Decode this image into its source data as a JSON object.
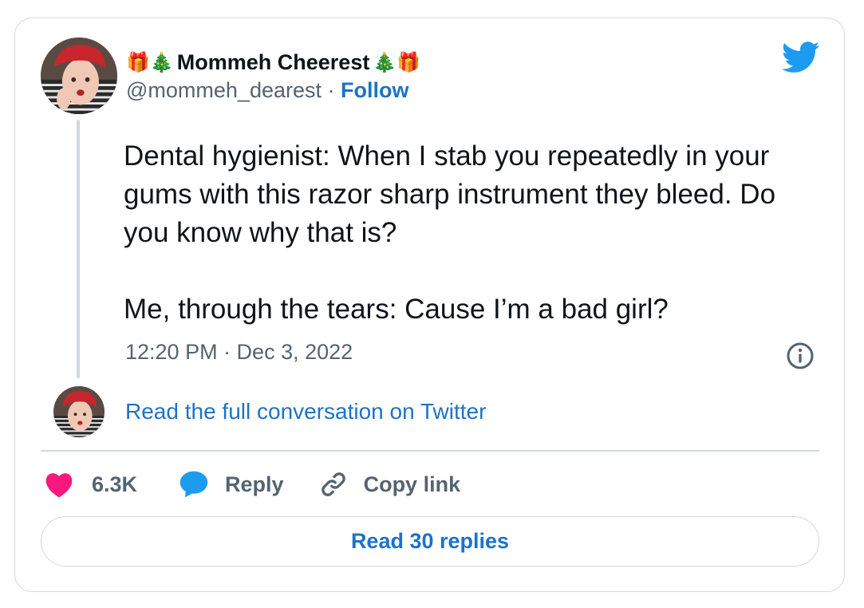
{
  "author": {
    "display_name": "Mommeh Cheerest",
    "name_emoji_left": "🎁🎄",
    "name_emoji_right": "🎄🎁",
    "handle": "@mommeh_dearest",
    "separator": "·",
    "follow_label": "Follow"
  },
  "tweet": {
    "text": "Dental hygienist: When I stab you repeatedly in your gums with this razor sharp instrument they bleed. Do you know why that is?\n\nMe, through the tears: Cause I’m a bad girl?",
    "timestamp": "12:20 PM · Dec 3, 2022"
  },
  "read_full_conversation_label": "Read the full conversation on Twitter",
  "actions": {
    "likes_count": "6.3K",
    "reply_label": "Reply",
    "copy_link_label": "Copy link"
  },
  "read_replies_label": "Read 30 replies",
  "icons": {
    "brand": "twitter-bird-icon",
    "info": "info-icon",
    "like": "heart-icon",
    "reply": "speech-bubble-icon",
    "copy": "link-icon"
  },
  "colors": {
    "twitter_blue": "#1d9bf0",
    "link_blue": "#1d72c8",
    "heart_pink": "#f91880",
    "secondary_text": "#536471",
    "border": "#cfd9de"
  }
}
